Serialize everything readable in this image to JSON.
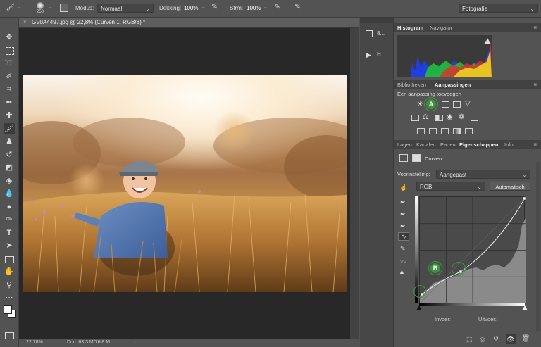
{
  "options_bar": {
    "brush_size": "250",
    "mode_label": "Modus:",
    "mode_value": "Normaal",
    "opacity_label": "Dekking:",
    "opacity_value": "100%",
    "flow_label": "Strm:",
    "flow_value": "100%",
    "workspace": "Fotografie"
  },
  "document": {
    "tab_title": "GV0A4497.jpg @ 22,8% (Curven 1, RGB/8) *",
    "close": "×",
    "zoom": "22,78%",
    "doc_info": "Doc: 63,3 M/76,8 M",
    "status_arrow": "›"
  },
  "collapsed_panels": [
    {
      "icon": "history-icon",
      "label": "8..."
    },
    {
      "icon": "play-icon",
      "label": "H..."
    }
  ],
  "histogram_panel": {
    "tabs": [
      "Histogram",
      "Navigator"
    ],
    "active": "Histogram",
    "warning": "!"
  },
  "adjustments_panel": {
    "tabs": [
      "Bibliotheken",
      "Aanpassingen"
    ],
    "active": "Aanpassingen",
    "title": "Een aanpassing toevoegen",
    "marker": "A"
  },
  "properties_panel": {
    "tabs": [
      "Lagen",
      "Kanalen",
      "Paden",
      "Eigenschappen",
      "Info"
    ],
    "active": "Eigenschappen",
    "layer_name": "Curven",
    "preset_label": "Voorinstelling:",
    "preset_value": "Aangepast",
    "channel_value": "RGB",
    "auto_button": "Automatisch",
    "input_label": "Invoer:",
    "output_label": "Uitvoer:",
    "marker": "B"
  },
  "colors": {
    "panel_bg": "#535353",
    "canvas_bg": "#282828",
    "marker_green": "#3f8f3f"
  }
}
